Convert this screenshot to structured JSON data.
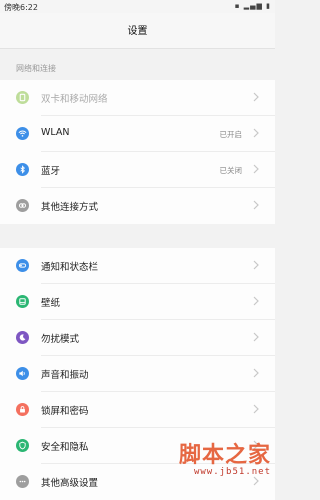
{
  "status_bar": {
    "time": "傍晚6:22",
    "indicators": "▪ ▂▄▆ ▮"
  },
  "header": {
    "title": "设置"
  },
  "section1": {
    "label": "网络和连接",
    "items": [
      {
        "label": "双卡和移动网络",
        "value": "",
        "icon": "sim-card-icon",
        "color": "#8bc34a",
        "disabled": true
      },
      {
        "label": "WLAN",
        "value": "已开启",
        "icon": "wifi-icon",
        "color": "#3d8fe8"
      },
      {
        "label": "蓝牙",
        "value": "已关闭",
        "icon": "bluetooth-icon",
        "color": "#3d8fe8"
      },
      {
        "label": "其他连接方式",
        "value": "",
        "icon": "link-icon",
        "color": "#9e9e9e"
      }
    ]
  },
  "section2": {
    "items": [
      {
        "label": "通知和状态栏",
        "value": "",
        "icon": "notification-icon",
        "color": "#3d8fe8"
      },
      {
        "label": "壁纸",
        "value": "",
        "icon": "wallpaper-icon",
        "color": "#2bb673"
      },
      {
        "label": "勿扰模式",
        "value": "",
        "icon": "moon-icon",
        "color": "#7e57c2"
      },
      {
        "label": "声音和振动",
        "value": "",
        "icon": "sound-icon",
        "color": "#3d8fe8"
      },
      {
        "label": "锁屏和密码",
        "value": "",
        "icon": "lock-icon",
        "color": "#f4705f"
      },
      {
        "label": "安全和隐私",
        "value": "",
        "icon": "shield-icon",
        "color": "#2bb673"
      },
      {
        "label": "其他高级设置",
        "value": "",
        "icon": "more-icon",
        "color": "#9e9e9e"
      }
    ]
  },
  "watermark": {
    "text": "脚本之家",
    "url": "www.jb51.net"
  }
}
